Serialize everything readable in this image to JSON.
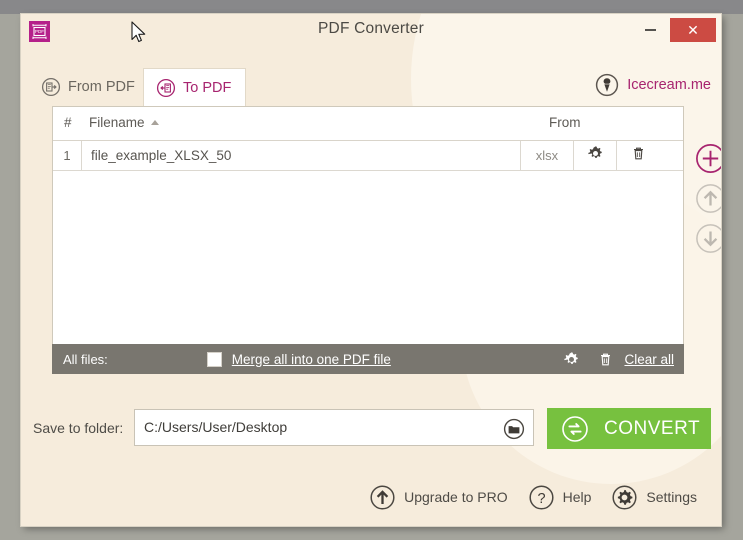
{
  "window": {
    "title": "PDF Converter",
    "app_icon": "pdf-app-icon",
    "minimize_label": "",
    "close_label": "✕"
  },
  "tabs": [
    {
      "id": "from-pdf",
      "label": "From PDF",
      "icon": "from-pdf-icon",
      "active": false
    },
    {
      "id": "to-pdf",
      "label": "To PDF",
      "icon": "to-pdf-icon",
      "active": true
    }
  ],
  "brand": {
    "label": "Icecream.me",
    "icon": "icecream-cone-icon"
  },
  "file_list": {
    "columns": {
      "number": "#",
      "filename": "Filename",
      "from": "From"
    },
    "sort": {
      "column": "Filename",
      "direction": "asc"
    },
    "rows": [
      {
        "number": "1",
        "filename": "file_example_XLSX_50",
        "from": "xlsx",
        "settings_icon": "gear-icon",
        "delete_icon": "trash-icon"
      }
    ]
  },
  "side_buttons": [
    {
      "id": "add-file",
      "icon": "plus-circle-icon",
      "enabled": true,
      "color": "#a7246f"
    },
    {
      "id": "move-up",
      "icon": "arrow-up-circle-icon",
      "enabled": false,
      "color": "#c2bdb4"
    },
    {
      "id": "move-down",
      "icon": "arrow-down-circle-icon",
      "enabled": false,
      "color": "#c2bdb4"
    }
  ],
  "all_files_bar": {
    "label": "All files:",
    "merge_checkbox_checked": false,
    "merge_label": "Merge all into one PDF file",
    "settings_icon": "gear-icon",
    "trash_icon": "trash-icon",
    "clear_all_label": "Clear all"
  },
  "save_row": {
    "label": "Save to folder:",
    "path_value": "C:/Users/User/Desktop",
    "path_placeholder": "C:/Users/User/Desktop",
    "browse_icon": "folder-icon",
    "convert_label": "CONVERT",
    "convert_icon": "convert-refresh-icon"
  },
  "bottom_bar": [
    {
      "id": "upgrade",
      "label": "Upgrade to PRO",
      "icon": "arrow-up-circle-icon"
    },
    {
      "id": "help",
      "label": "Help",
      "icon": "question-circle-icon"
    },
    {
      "id": "settings",
      "label": "Settings",
      "icon": "gear-circle-icon"
    }
  ],
  "colors": {
    "accent": "#a7246f",
    "window_bg": "#f6ecdc",
    "convert_green": "#77c13f",
    "close_red": "#cc4b43",
    "bar_gray": "#79766f"
  }
}
